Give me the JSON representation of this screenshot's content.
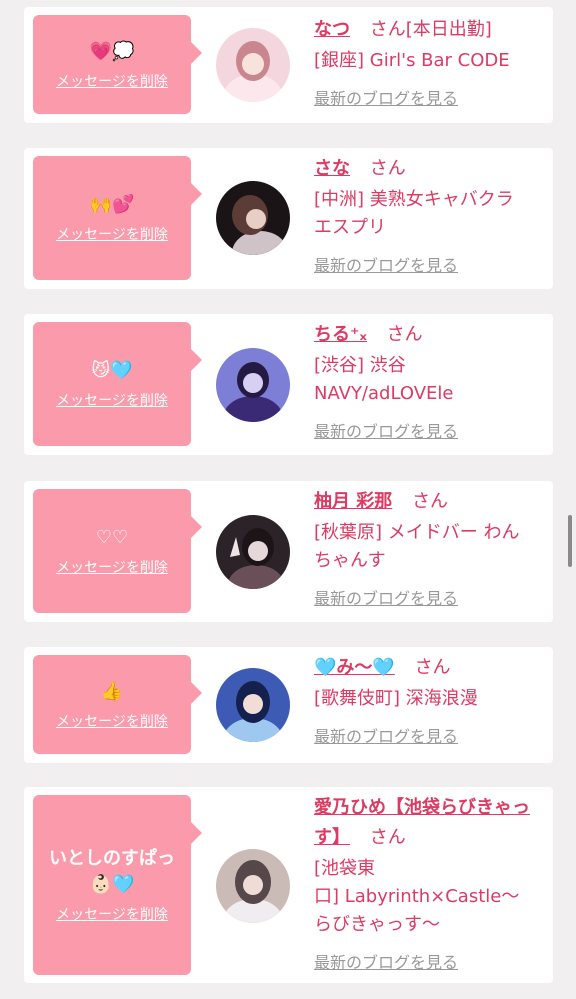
{
  "messages": [
    {
      "message": "💗💭",
      "delete_label": "メッセージを削除",
      "name": "なつ",
      "suffix": "さん",
      "badge": "[本日出勤]",
      "shop_lines": [
        "[銀座] Girl's Bar CODE"
      ],
      "blog_label": "最新のブログを見る",
      "avatar_colors": [
        "#f4d6de",
        "#c9868f",
        "#fbe7ec"
      ]
    },
    {
      "message": "🙌💕",
      "delete_label": "メッセージを削除",
      "name": "さな",
      "suffix": "さん",
      "badge": "",
      "shop_lines": [
        "[中洲] 美熟女キャバクラ",
        "エスプリ"
      ],
      "blog_label": "最新のブログを見る",
      "avatar_colors": [
        "#1a1417",
        "#5b3c36",
        "#cfc3c8"
      ]
    },
    {
      "message": "😼🩵",
      "delete_label": "メッセージを削除",
      "name": "ちる⁺ₓ",
      "suffix": "さん",
      "badge": "",
      "shop_lines": [
        "[渋谷] 渋谷",
        "NAVY/adLOVEle"
      ],
      "blog_label": "最新のブログを見る",
      "avatar_colors": [
        "#7d7fd6",
        "#3a2a76",
        "#d8d0f2"
      ]
    },
    {
      "message": "♡♡",
      "delete_label": "メッセージを削除",
      "name": "柚月 彩那",
      "suffix": "さん",
      "badge": "",
      "shop_lines": [
        "[秋葉原] メイドバー わん",
        "ちゃんす"
      ],
      "blog_label": "最新のブログを見る",
      "avatar_colors": [
        "#2b2327",
        "#6b4f58",
        "#e6d7db"
      ]
    },
    {
      "message": "👍",
      "delete_label": "メッセージを削除",
      "name": "🩵み〜🩵",
      "suffix": "さん",
      "badge": "",
      "shop_lines": [
        "[歌舞伎町] 深海浪漫"
      ],
      "blog_label": "最新のブログを見る",
      "avatar_colors": [
        "#3d5ab5",
        "#14204e",
        "#9fc8f0"
      ]
    },
    {
      "message": "いとしのすぱっ👶🏻🩵",
      "delete_label": "メッセージを削除",
      "name": "愛乃ひめ【池袋らびきゃっす】",
      "suffix": "さん",
      "badge": "",
      "shop_lines": [
        "[池袋東",
        "口] Labyrinth×Castle〜",
        "らびきゃっす〜"
      ],
      "blog_label": "最新のブログを見る",
      "avatar_colors": [
        "#cbbbb7",
        "#56474a",
        "#f0ecef"
      ]
    }
  ]
}
